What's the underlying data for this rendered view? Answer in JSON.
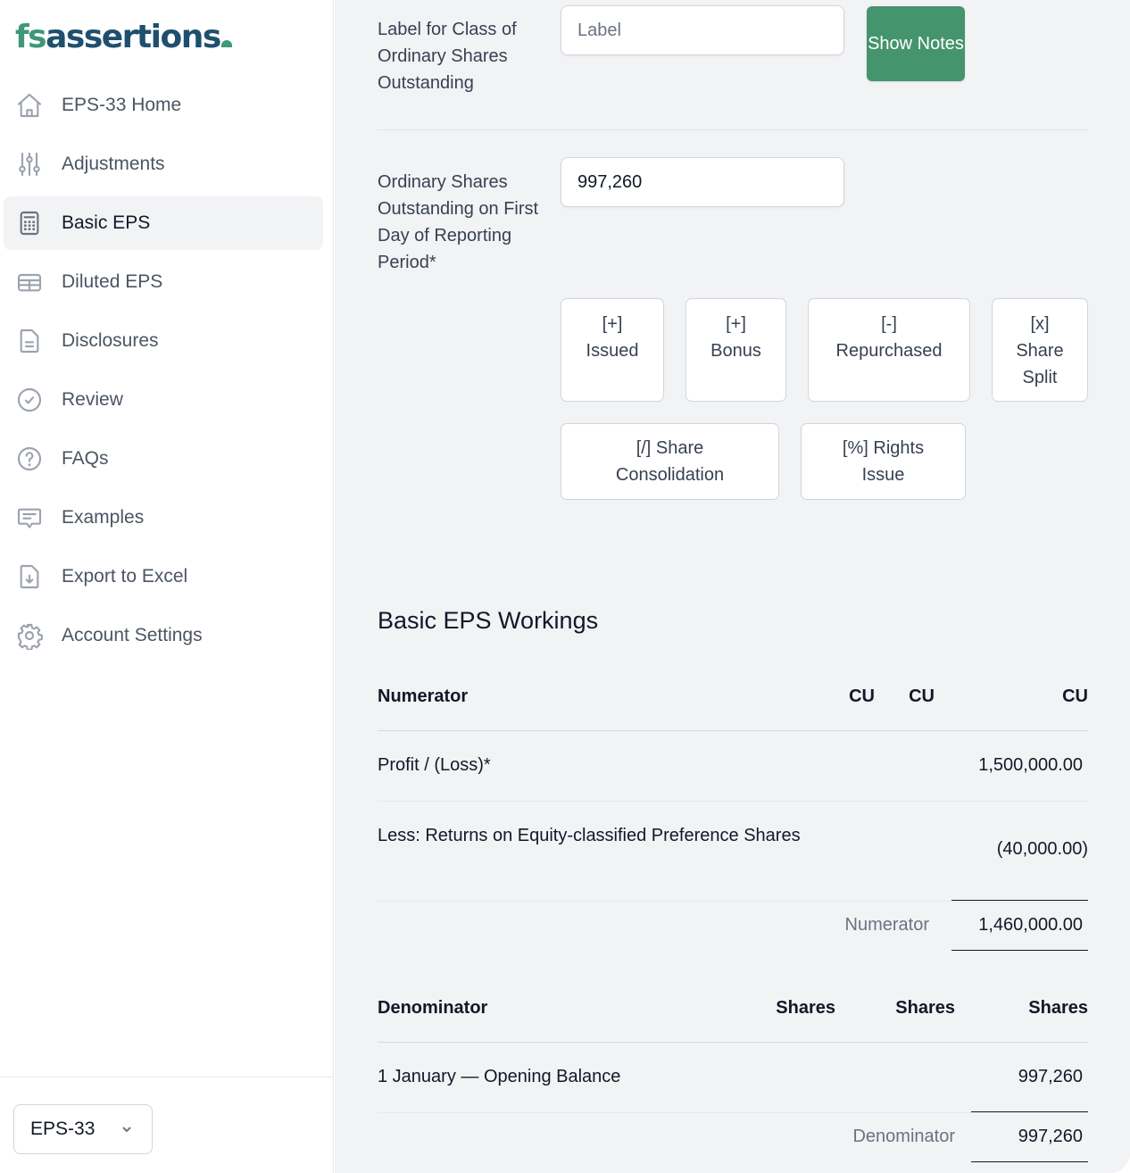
{
  "app": {
    "logo_part1": "fs",
    "logo_part2": "assertions",
    "brand_color": "#3f9877",
    "brand_dark": "#1f4f6e"
  },
  "sidebar": {
    "items": [
      {
        "label": "EPS-33 Home",
        "icon": "home-icon",
        "active": false
      },
      {
        "label": "Adjustments",
        "icon": "sliders-icon",
        "active": false
      },
      {
        "label": "Basic EPS",
        "icon": "calculator-icon",
        "active": true
      },
      {
        "label": "Diluted EPS",
        "icon": "table-icon",
        "active": false
      },
      {
        "label": "Disclosures",
        "icon": "document-icon",
        "active": false
      },
      {
        "label": "Review",
        "icon": "check-circle-icon",
        "active": false
      },
      {
        "label": "FAQs",
        "icon": "question-circle-icon",
        "active": false
      },
      {
        "label": "Examples",
        "icon": "chat-icon",
        "active": false
      },
      {
        "label": "Export to Excel",
        "icon": "file-download-icon",
        "active": false
      },
      {
        "label": "Account Settings",
        "icon": "gear-icon",
        "active": false
      }
    ],
    "standard_select": {
      "value": "EPS-33"
    }
  },
  "form": {
    "class_label": {
      "label": "Label for Class of Ordinary Shares Outstanding",
      "placeholder": "Label",
      "value": ""
    },
    "show_notes_label": "Show Notes",
    "opening_shares": {
      "label": "Ordinary Shares Outstanding on First Day of Reporting Period*",
      "value": "997,260"
    },
    "adjustment_buttons": [
      {
        "symbol": "[+]",
        "label": "Issued"
      },
      {
        "symbol": "[+]",
        "label": "Bonus"
      },
      {
        "symbol": "[-]",
        "label": "Repurchased"
      },
      {
        "symbol": "[x]",
        "label": "Share Split"
      },
      {
        "symbol": "[/]",
        "label": "Share Consolidation"
      },
      {
        "symbol": "[%]",
        "label": "Rights Issue"
      }
    ]
  },
  "workings": {
    "title": "Basic EPS Workings",
    "numerator": {
      "header": "Numerator",
      "columns": [
        "CU",
        "CU",
        "CU"
      ],
      "rows": [
        {
          "label": "Profit / (Loss)*",
          "value": "1,500,000.00"
        },
        {
          "label": "Less: Returns on Equity-classified Preference Shares",
          "value": "(40,000.00)"
        }
      ],
      "total_label": "Numerator",
      "total_value": "1,460,000.00"
    },
    "denominator": {
      "header": "Denominator",
      "columns": [
        "Shares",
        "Shares",
        "Shares"
      ],
      "rows": [
        {
          "label": "1 January — Opening Balance",
          "value": "997,260"
        }
      ],
      "total_label": "Denominator",
      "total_value": "997,260"
    }
  }
}
